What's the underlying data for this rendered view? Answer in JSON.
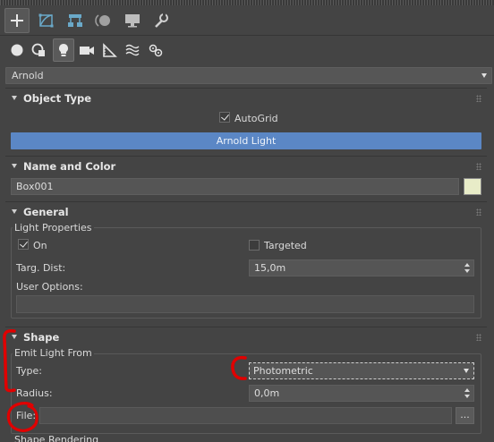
{
  "toolbar": {
    "tabs": [
      {
        "icon": "create-icon",
        "active": true
      },
      {
        "icon": "modify-icon",
        "active": false
      },
      {
        "icon": "hierarchy-icon",
        "active": false
      },
      {
        "icon": "motion-icon",
        "active": false
      },
      {
        "icon": "display-icon",
        "active": false
      },
      {
        "icon": "utilities-icon",
        "active": false
      }
    ],
    "categories": [
      {
        "icon": "geometry-icon",
        "active": false
      },
      {
        "icon": "shapes-icon",
        "active": false
      },
      {
        "icon": "lights-icon",
        "active": true
      },
      {
        "icon": "cameras-icon",
        "active": false
      },
      {
        "icon": "helpers-icon",
        "active": false
      },
      {
        "icon": "space-warps-icon",
        "active": false
      },
      {
        "icon": "systems-icon",
        "active": false
      }
    ]
  },
  "renderer_dropdown": {
    "value": "Arnold"
  },
  "object_type": {
    "title": "Object Type",
    "autogrid_label": "AutoGrid",
    "autogrid_checked": true,
    "button_label": "Arnold Light"
  },
  "name_color": {
    "title": "Name and Color",
    "name_value": "Box001",
    "swatch_color": "#e8ecc8"
  },
  "general": {
    "title": "General",
    "group_label": "Light Properties",
    "on_label": "On",
    "on_checked": true,
    "targeted_label": "Targeted",
    "targeted_checked": false,
    "targ_dist_label": "Targ. Dist:",
    "targ_dist_value": "15,0m",
    "user_options_label": "User Options:",
    "user_options_value": ""
  },
  "shape": {
    "title": "Shape",
    "group_label": "Emit Light From",
    "type_label": "Type:",
    "type_value": "Photometric",
    "radius_label": "Radius:",
    "radius_value": "0,0m",
    "file_label": "File:",
    "file_value": "",
    "browse_label": "...",
    "next_group_label": "Shape Rendering"
  },
  "colors": {
    "background": "#444444",
    "accent_button": "#5b87c5",
    "annotation": "#e00000"
  }
}
